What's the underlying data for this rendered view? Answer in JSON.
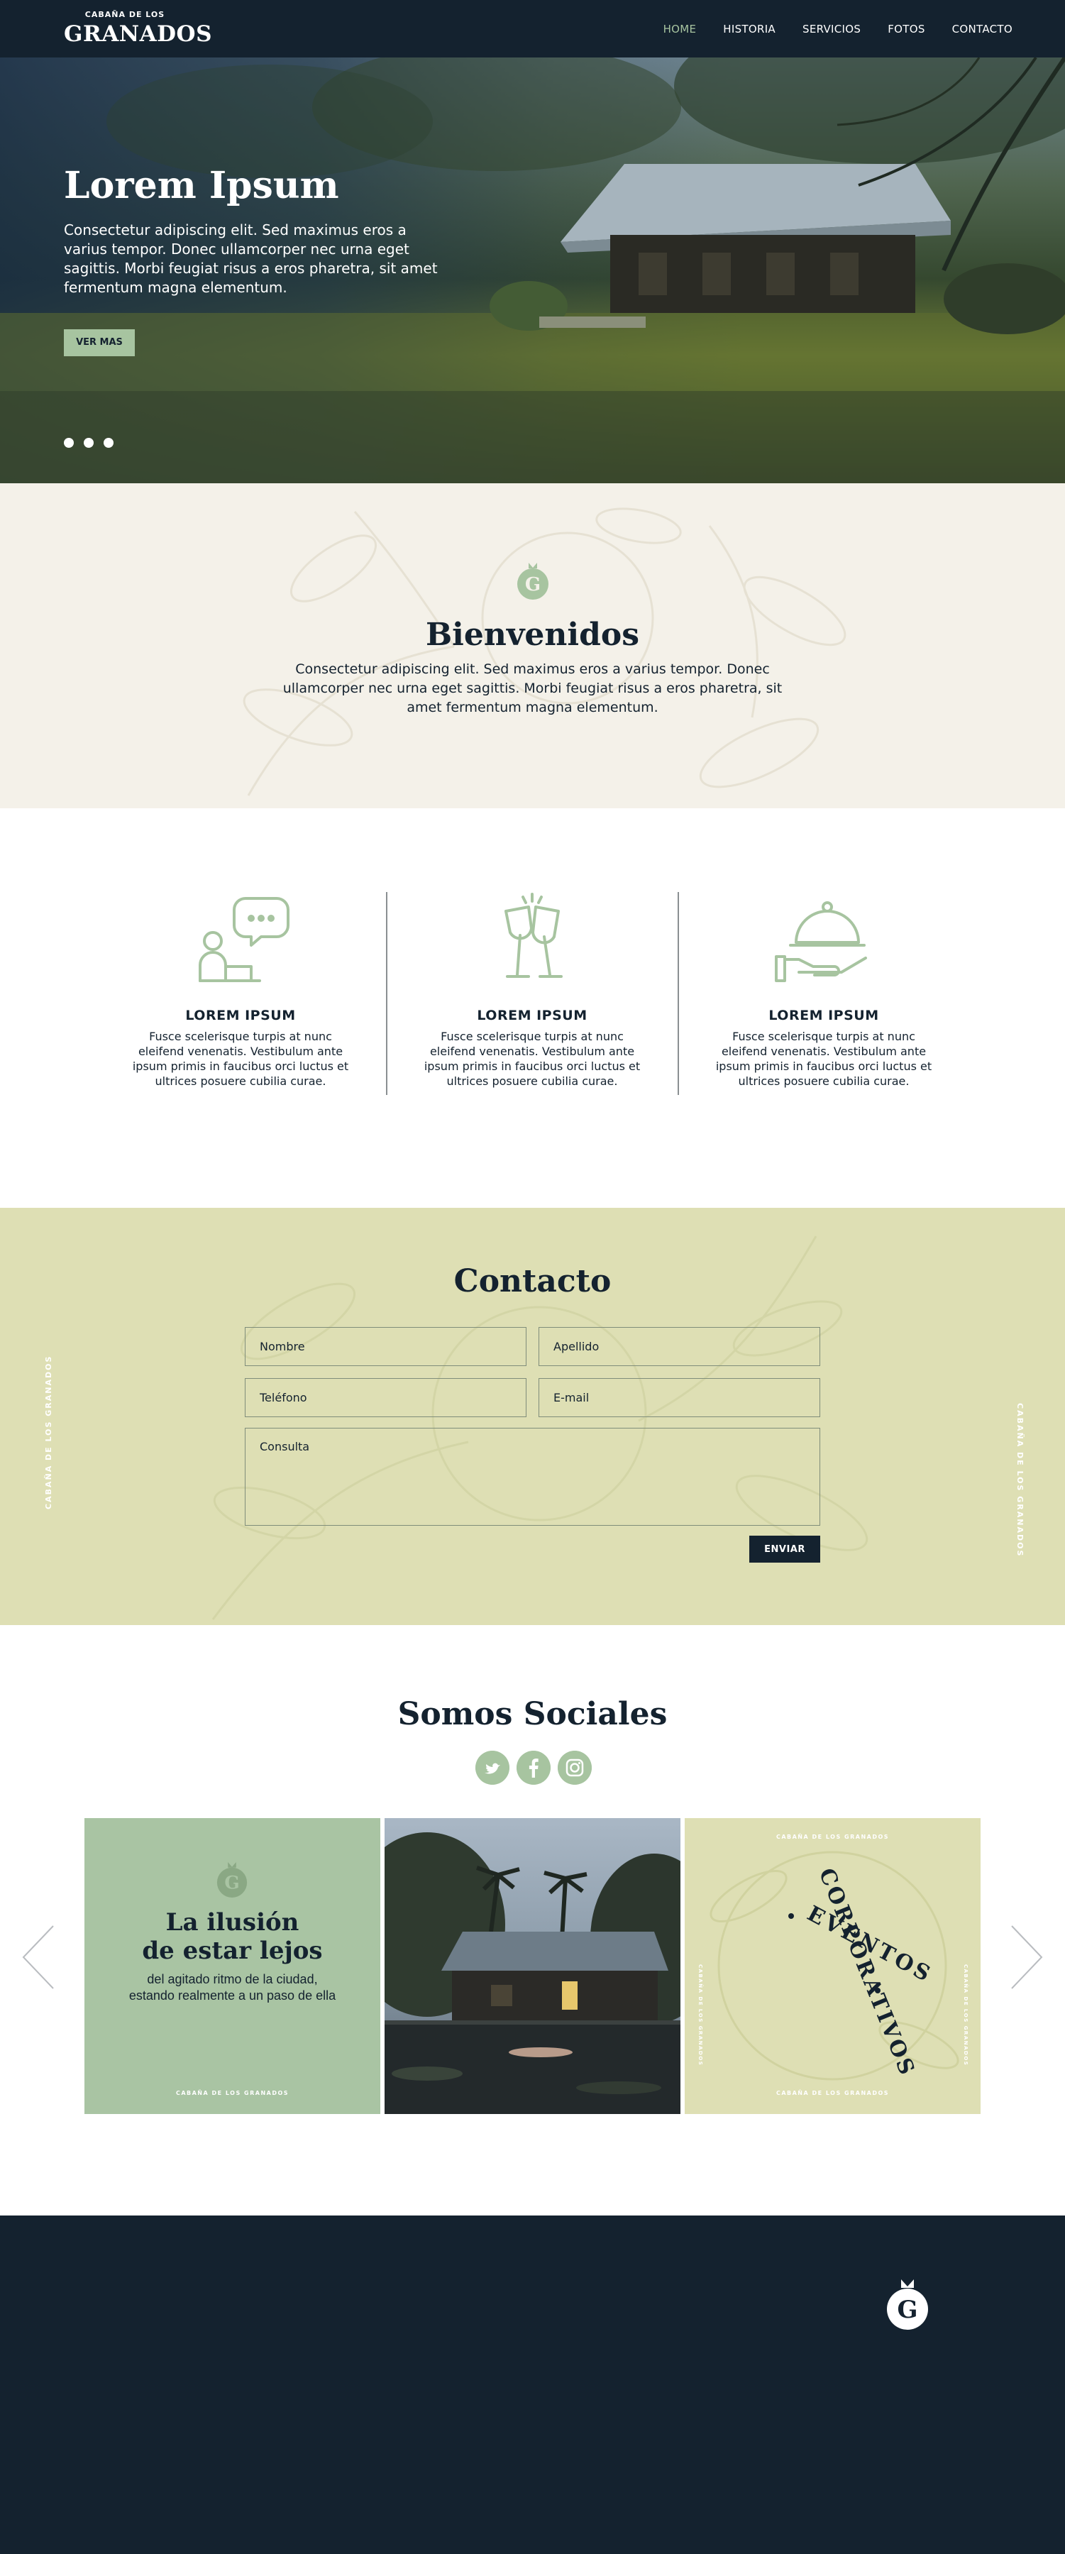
{
  "brand": {
    "line1": "CABAÑA DE LOS",
    "line2": "GRANADOS"
  },
  "nav": {
    "items": [
      {
        "label": "HOME",
        "active": true
      },
      {
        "label": "HISTORIA"
      },
      {
        "label": "SERVICIOS"
      },
      {
        "label": "FOTOS"
      },
      {
        "label": "CONTACTO"
      }
    ]
  },
  "hero": {
    "title": "Lorem Ipsum",
    "text": "Consectetur adipiscing elit. Sed maximus eros a varius tempor. Donec ullamcorper nec urna eget sagittis. Morbi feugiat risus a eros pharetra, sit amet fermentum magna elementum.",
    "button": "VER MAS",
    "slides": 3
  },
  "welcome": {
    "title": "Bienvenidos",
    "text": "Consectetur adipiscing elit. Sed maximus eros a varius tempor. Donec ullamcorper nec urna eget sagittis. Morbi feugiat risus a eros pharetra, sit amet fermentum magna elementum."
  },
  "features": [
    {
      "icon": "chat-person-icon",
      "title": "LOREM IPSUM",
      "text": "Fusce scelerisque turpis at nunc eleifend venenatis. Vestibulum ante ipsum primis in faucibus orci luctus et ultrices posuere cubilia curae."
    },
    {
      "icon": "champagne-glasses-icon",
      "title": "LOREM IPSUM",
      "text": "Fusce scelerisque turpis at nunc eleifend venenatis. Vestibulum ante ipsum primis in faucibus orci luctus et ultrices posuere cubilia curae."
    },
    {
      "icon": "serving-cloche-icon",
      "title": "LOREM IPSUM",
      "text": "Fusce scelerisque turpis at nunc eleifend venenatis. Vestibulum ante ipsum primis in faucibus orci luctus et ultrices posuere cubilia curae."
    }
  ],
  "contact": {
    "title": "Contacto",
    "fields": {
      "nombre": "Nombre",
      "apellido": "Apellido",
      "telefono": "Teléfono",
      "email": "E-mail",
      "consulta": "Consulta"
    },
    "submit": "ENVIAR",
    "side_label": "CABAÑA DE LOS GRANADOS"
  },
  "social": {
    "title": "Somos Sociales",
    "networks": [
      "twitter-icon",
      "facebook-icon",
      "instagram-icon"
    ],
    "card1": {
      "title_line1": "La ilusión",
      "title_line2": "de estar lejos",
      "text": "del agitado ritmo de la ciudad, estando realmente a un paso de ella",
      "footer": "CABAÑA DE LOS GRANADOS"
    },
    "card3": {
      "top": "CABAÑA DE LOS GRANADOS",
      "bottom": "CABAÑA DE LOS GRANADOS",
      "side": "CABAÑA DE LOS GRANADOS",
      "word1": "EVENTOS",
      "word2": "CORPORATIVOS"
    }
  },
  "colors": {
    "navy": "#14222f",
    "sage": "#a7c4a0",
    "khaki": "#dedfb4",
    "cream": "#f4f1e9"
  }
}
